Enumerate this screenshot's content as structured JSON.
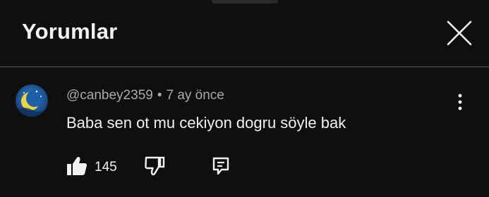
{
  "header": {
    "title": "Yorumlar"
  },
  "icons": {
    "close": "close-icon",
    "more": "more-vertical-icon",
    "like": "thumbs-up-icon",
    "dislike": "thumbs-down-icon",
    "reply": "reply-comment-icon"
  },
  "comment": {
    "author": "@canbey2359",
    "separator": "•",
    "time": "7 ay önce",
    "text": "Baba sen ot mu cekiyon dogru söyle bak",
    "like_count": "145"
  },
  "colors": {
    "background": "#0f0f0f",
    "primary_text": "#f1f1f1",
    "secondary_text": "#aaaaaa",
    "avatar_blue": "#1f5fa8",
    "avatar_moon": "#e8d34a"
  }
}
